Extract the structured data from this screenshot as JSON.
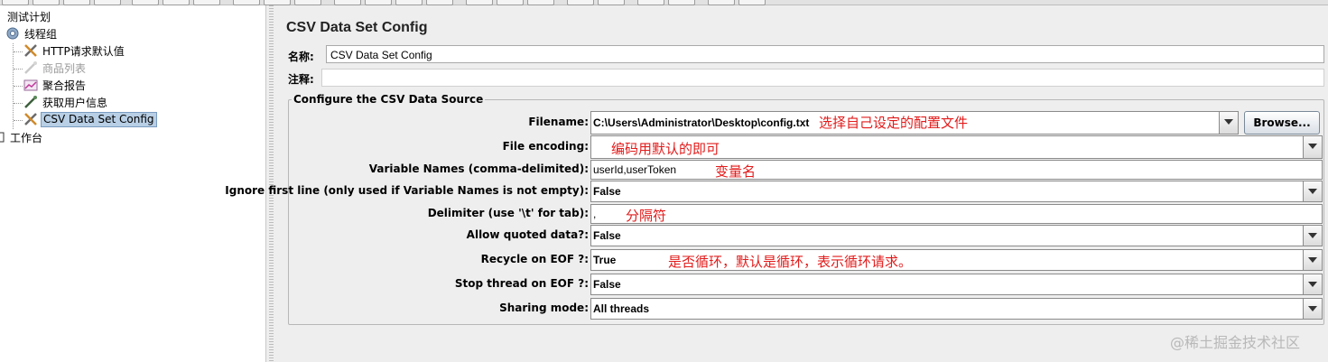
{
  "tree": {
    "items": [
      {
        "label": "测试计划",
        "icon": "test-plan-icon"
      },
      {
        "label": "线程组",
        "icon": "thread-group-gear-icon"
      },
      {
        "label": "HTTP请求默认值",
        "icon": "wrench-tools-icon"
      },
      {
        "label": "商品列表",
        "icon": "pipette-sampler-icon",
        "disabled": true
      },
      {
        "label": "聚合报告",
        "icon": "chart-report-icon"
      },
      {
        "label": "获取用户信息",
        "icon": "pipette-sampler-icon"
      },
      {
        "label": "CSV Data Set Config",
        "icon": "wrench-tools-icon",
        "selected": true
      },
      {
        "label": "工作台",
        "icon": "workbench-icon"
      }
    ]
  },
  "panel": {
    "title": "CSV Data Set Config",
    "name_label": "名称:",
    "name_value": "CSV Data Set Config",
    "comment_label": "注释:",
    "comment_value": "",
    "group_title": "Configure the CSV Data Source"
  },
  "fields": {
    "filename": {
      "label": "Filename:",
      "value": "C:\\Users\\Administrator\\Desktop\\config.txt"
    },
    "browse_label": "Browse...",
    "encoding": {
      "label": "File encoding:",
      "value": ""
    },
    "variable_names": {
      "label": "Variable Names (comma-delimited):",
      "value": "userId,userToken"
    },
    "ignore_first": {
      "label": "Ignore first line (only used if Variable Names is not empty):",
      "value": "False"
    },
    "delimiter": {
      "label": "Delimiter (use '\\t' for tab):",
      "value": ","
    },
    "allow_quoted": {
      "label": "Allow quoted data?:",
      "value": "False"
    },
    "recycle": {
      "label": "Recycle on EOF ?:",
      "value": "True"
    },
    "stop_thread": {
      "label": "Stop thread on EOF ?:",
      "value": "False"
    },
    "sharing": {
      "label": "Sharing mode:",
      "value": "All threads"
    }
  },
  "annotations": {
    "filename_note": "选择自己设定的配置文件",
    "encoding_note": "编码用默认的即可",
    "varnames_note": "变量名",
    "delimiter_note": "分隔符",
    "recycle_note": "是否循环，默认是循环，表示循环请求。"
  },
  "watermark": "@稀土掘金技术社区",
  "colors": {
    "annotation": "#e21b1b",
    "selection": "#b8cfe5"
  }
}
